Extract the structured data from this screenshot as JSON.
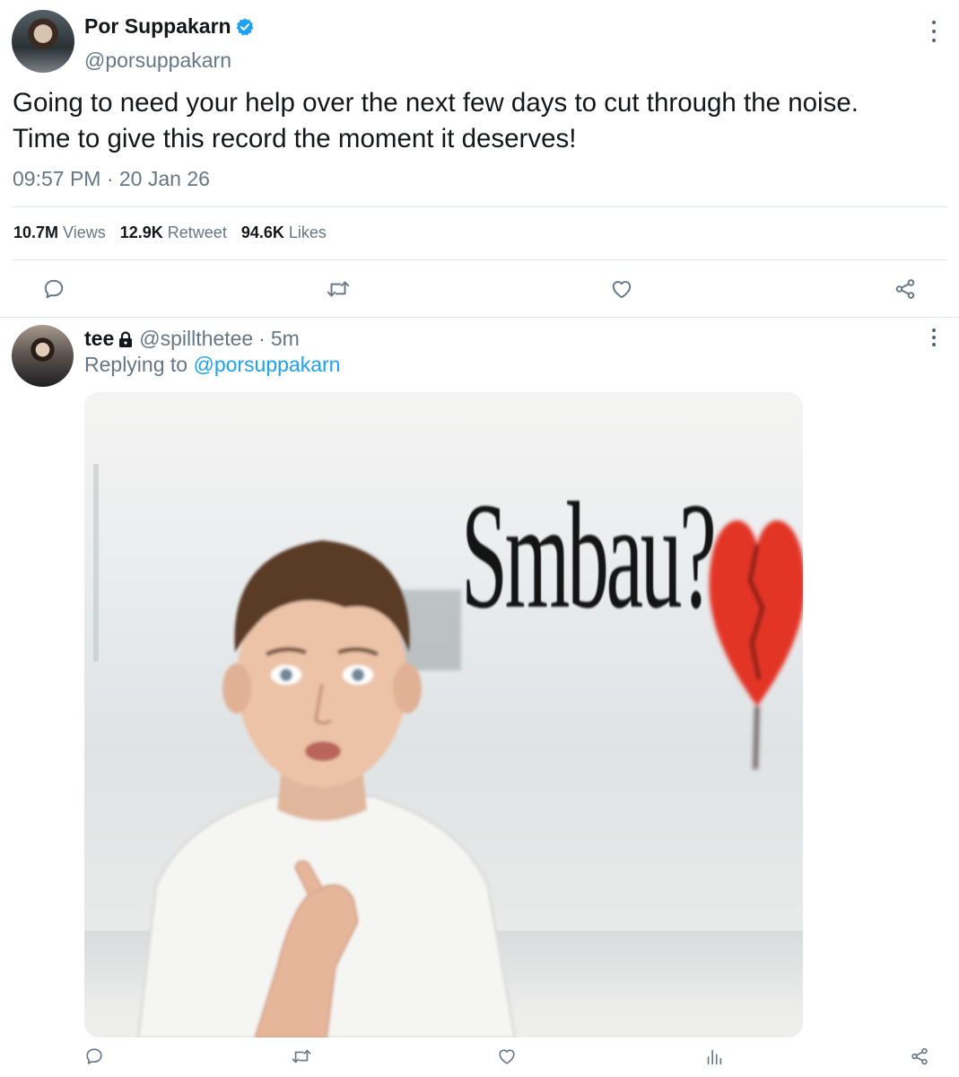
{
  "tweet": {
    "author": {
      "display_name": "Por Suppakarn",
      "handle": "@porsuppakarn",
      "verified": true
    },
    "text_lines": [
      "Going to need your help over the next few days to cut through the noise.",
      "Time to give this record the moment it deserves!"
    ],
    "timestamp": "09:57 PM · 20 Jan 26",
    "stats": {
      "views_value": "10.7M",
      "views_label": "Views",
      "retweets_value": "12.9K",
      "retweets_label": "Retweet",
      "likes_value": "94.6K",
      "likes_label": "Likes"
    },
    "actions": [
      "reply-icon",
      "retweet-icon",
      "like-icon",
      "share-icon"
    ]
  },
  "reply": {
    "author": {
      "display_name": "tee",
      "handle": "@spillthetee",
      "protected": true
    },
    "dot": "·",
    "time": "5m",
    "replying_prefix": "Replying to",
    "replying_to": "@porsuppakarn",
    "media_caption": "Smbau?",
    "actions": [
      "reply-icon",
      "retweet-icon",
      "like-icon",
      "views-icon",
      "share-icon"
    ]
  },
  "colors": {
    "text": "#14171a",
    "secondary": "#657786",
    "link": "#1da1f2",
    "verified": "#1da1f2",
    "divider": "#e1e8ed"
  }
}
